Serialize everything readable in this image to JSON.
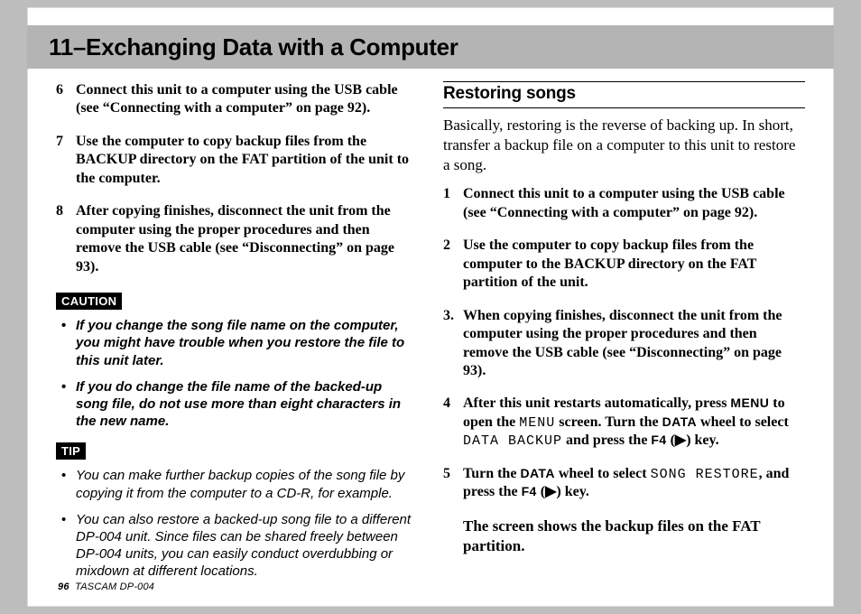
{
  "chapter_title": "11–Exchanging Data with a Computer",
  "left": {
    "steps": [
      {
        "n": "6",
        "html": "Connect this unit to a computer using the USB cable (see “<b>Connecting with a computer</b>” on page 92)."
      },
      {
        "n": "7",
        "html": "Use the computer to copy backup files from the BACKUP directory on the FAT partition of the unit to the computer."
      },
      {
        "n": "8",
        "html": "After copying finishes, disconnect the unit from the computer using the proper procedures and then remove the USB cable (see “Disconnecting” on page 93)."
      }
    ],
    "caution_label": "CAUTION",
    "caution": [
      "If you change the song file name on the computer, you might have trouble when you restore the file to this unit later.",
      "If you do change the file name of the backed-up song file, do not use more than eight characters in the new name."
    ],
    "tip_label": "TIP",
    "tip": [
      "You can make further backup copies of the song file by copying it from the computer to a CD-R, for example.",
      "You can also restore a backed-up song file to a different DP-004 unit. Since files can be shared freely between DP-004 units, you can easily conduct overdubbing or mixdown at different locations."
    ]
  },
  "right": {
    "section_title": "Restoring songs",
    "intro": "Basically, restoring is the reverse of backing up. In short, transfer a backup file on a computer to this unit to restore a song.",
    "steps": [
      {
        "n": "1",
        "html": "Connect this unit to a computer using the USB cable (see “<b>Connecting with a computer</b>” on page 92)."
      },
      {
        "n": "2",
        "html": "Use the computer to copy backup files from the computer to the BACKUP directory on the FAT partition of the unit."
      },
      {
        "n": "3.",
        "html": "When copying finishes, disconnect the unit from the computer using the proper procedures and then remove the USB cable (see “Disconnecting” on page 93)."
      },
      {
        "n": "4",
        "html": "After this unit restarts automatically, press <span class='menu'>MENU</span> to open the <span class='lcd'>MENU</span> screen. Turn the <span class='data'>DATA</span> wheel to select <span class='lcd'>DATA BACKUP</span> and press the <span class='f4'>F4</span> (<span class='tri'>▶</span>) key."
      },
      {
        "n": "5",
        "html": "Turn the <span class='data'>DATA</span> wheel to select <span class='lcd'>SONG RESTORE</span>, and press the <span class='f4'>F4</span> (<span class='tri'>▶</span>) key."
      }
    ],
    "outro": "The screen shows the backup files on the FAT partition."
  },
  "footer": {
    "page": "96",
    "product": "TASCAM  DP-004"
  }
}
